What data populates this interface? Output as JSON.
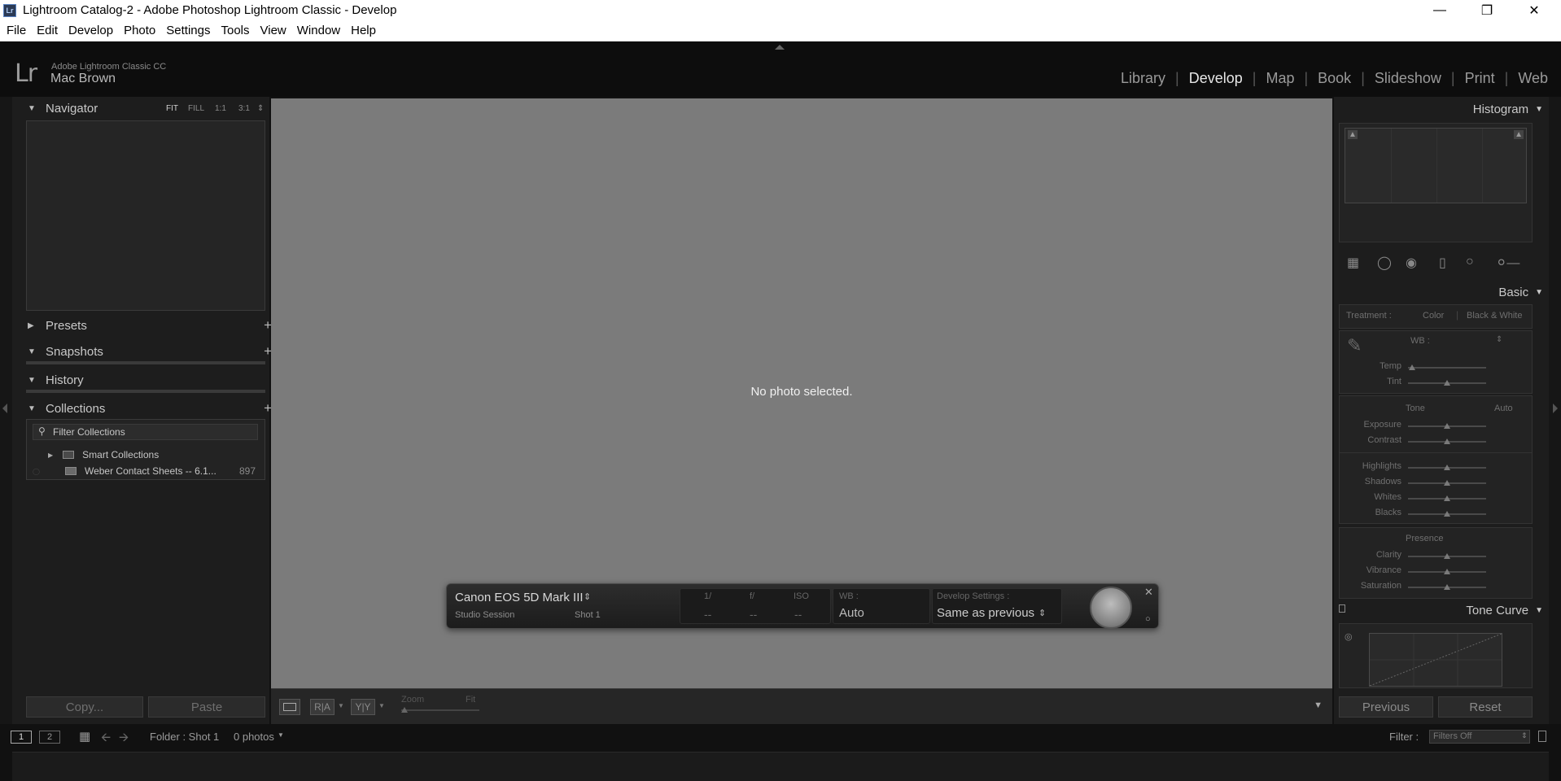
{
  "window": {
    "title": "Lightroom Catalog-2 - Adobe Photoshop Lightroom Classic - Develop",
    "icon_text": "Lr"
  },
  "menu": [
    "File",
    "Edit",
    "Develop",
    "Photo",
    "Settings",
    "Tools",
    "View",
    "Window",
    "Help"
  ],
  "identity": {
    "logo": "Lr",
    "product": "Adobe Lightroom Classic CC",
    "user": "Mac Brown"
  },
  "modules": [
    "Library",
    "Develop",
    "Map",
    "Book",
    "Slideshow",
    "Print",
    "Web"
  ],
  "active_module": "Develop",
  "left": {
    "navigator": "Navigator",
    "zoom": [
      "FIT",
      "FILL",
      "1:1",
      "3:1"
    ],
    "presets": "Presets",
    "snapshots": "Snapshots",
    "history": "History",
    "collections": "Collections",
    "filter_placeholder": "Filter Collections",
    "smart_collections": "Smart Collections",
    "collection_name": "Weber Contact Sheets -- 6.1...",
    "collection_count": "897",
    "copy": "Copy...",
    "paste": "Paste"
  },
  "center": {
    "message": "No photo selected.",
    "tether": {
      "camera": "Canon EOS 5D Mark III",
      "session": "Studio Session",
      "shot": "Shot 1",
      "shutter_label": "1/",
      "aperture_label": "f/",
      "iso_label": "ISO",
      "shutter_val": "--",
      "aperture_val": "--",
      "iso_val": "--",
      "wb_label": "WB :",
      "wb_val": "Auto",
      "dev_label": "Develop Settings :",
      "dev_val": "Same as previous"
    },
    "toolbar": {
      "zoom_label": "Zoom",
      "zoom_val": "Fit",
      "ra": "R|A",
      "yy": "Y|Y"
    }
  },
  "right": {
    "histogram": "Histogram",
    "basic": "Basic",
    "treatment_label": "Treatment :",
    "treatment_color": "Color",
    "treatment_bw": "Black & White",
    "wb_label": "WB :",
    "sliders_wb": [
      "Temp",
      "Tint"
    ],
    "tone_label": "Tone",
    "tone_auto": "Auto",
    "sliders_tone1": [
      "Exposure",
      "Contrast"
    ],
    "sliders_tone2": [
      "Highlights",
      "Shadows",
      "Whites",
      "Blacks"
    ],
    "presence_label": "Presence",
    "sliders_presence": [
      "Clarity",
      "Vibrance",
      "Saturation"
    ],
    "tone_curve": "Tone Curve",
    "previous": "Previous",
    "reset": "Reset"
  },
  "filmstrip": {
    "screen1": "1",
    "screen2": "2",
    "folder": "Folder : Shot 1",
    "photos": "0 photos",
    "filter_label": "Filter :",
    "filter_val": "Filters Off"
  }
}
